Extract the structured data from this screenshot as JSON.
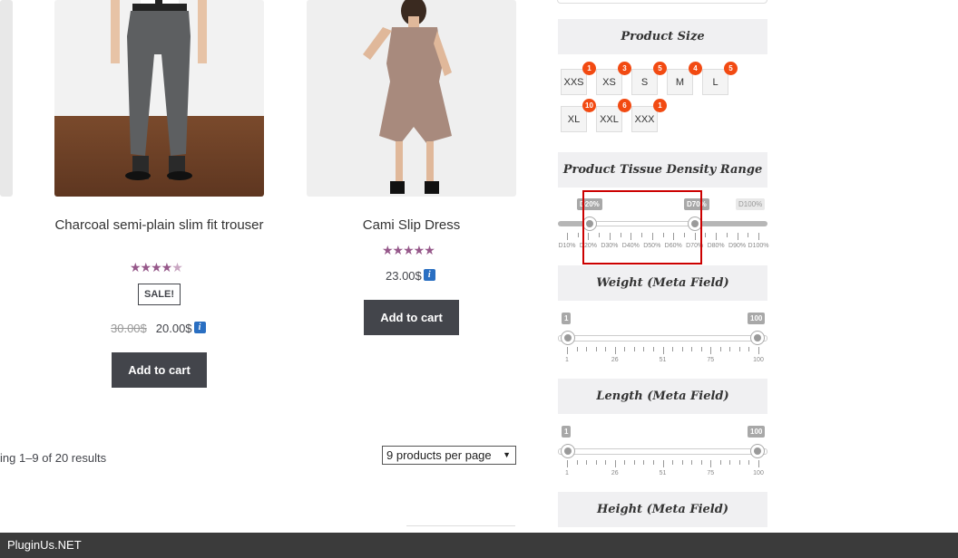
{
  "products": [
    {
      "title": "Charcoal semi-plain slim fit trouser",
      "rating_stars": 4.5,
      "badge": "SALE!",
      "old_price": "30.00$",
      "price": "20.00$",
      "button": "Add to cart"
    },
    {
      "title": "Cami Slip Dress",
      "rating_stars": 5,
      "price": "23.00$",
      "button": "Add to cart"
    }
  ],
  "results_text": "ing 1–9 of 20 results",
  "per_page": "9 products per page",
  "sidebar": {
    "size_title": "Product Size",
    "sizes": [
      {
        "label": "XXS",
        "count": "1"
      },
      {
        "label": "XS",
        "count": "3"
      },
      {
        "label": "S",
        "count": "5"
      },
      {
        "label": "M",
        "count": "4"
      },
      {
        "label": "L",
        "count": "5"
      },
      {
        "label": "XL",
        "count": "10"
      },
      {
        "label": "XXL",
        "count": "6"
      },
      {
        "label": "XXX",
        "count": "1"
      }
    ],
    "density": {
      "title": "Product Tissue Density Range",
      "from_label": "D20%",
      "to_label": "D70%",
      "max_label": "D100%",
      "ticks": [
        "D10%",
        "D20%",
        "D30%",
        "D40%",
        "D50%",
        "D60%",
        "D70%",
        "D80%",
        "D90%",
        "D100%"
      ]
    },
    "weight": {
      "title": "Weight (Meta Field)",
      "min": "1",
      "max": "100",
      "ticks": [
        "1",
        "26",
        "51",
        "75",
        "100"
      ]
    },
    "length": {
      "title": "Length (Meta Field)",
      "min": "1",
      "max": "100",
      "ticks": [
        "1",
        "26",
        "51",
        "75",
        "100"
      ]
    },
    "height": {
      "title": "Height (Meta Field)"
    }
  },
  "footer": "PluginUs.NET",
  "colors": {
    "accent_star": "#96588a",
    "button_bg": "#43454b",
    "badge": "#f24a12",
    "highlight": "#cc0000"
  }
}
